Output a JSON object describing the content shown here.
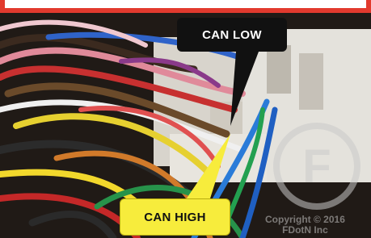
{
  "callouts": {
    "can_low": "CAN LOW",
    "can_high": "CAN HIGH"
  },
  "watermark": {
    "text_line1": "Copyright © 2016",
    "text_line2": "FDotN Inc",
    "logo_letter": "F"
  },
  "colors": {
    "accent_red": "#e23a2e",
    "callout_dark": "#111111",
    "callout_yellow": "#f7ec3c"
  }
}
